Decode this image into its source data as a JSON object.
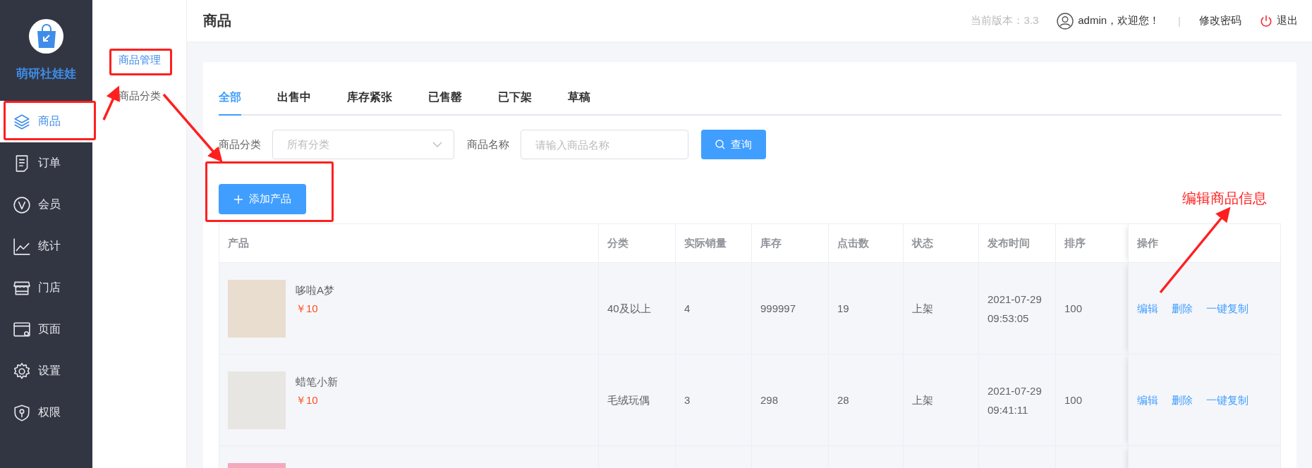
{
  "brand": {
    "name": "萌研社娃娃"
  },
  "nav": [
    {
      "label": "商品",
      "selected": true
    },
    {
      "label": "订单",
      "selected": false
    },
    {
      "label": "会员",
      "selected": false
    },
    {
      "label": "统计",
      "selected": false
    },
    {
      "label": "门店",
      "selected": false
    },
    {
      "label": "页面",
      "selected": false
    },
    {
      "label": "设置",
      "selected": false
    },
    {
      "label": "权限",
      "selected": false
    }
  ],
  "subnav": [
    {
      "label": "商品管理",
      "selected": true
    },
    {
      "label": "商品分类",
      "selected": false
    }
  ],
  "header": {
    "title": "商品",
    "version": "当前版本：3.3",
    "user": "admin，欢迎您！",
    "separator": "|",
    "change_password": "修改密码",
    "logout": "退出"
  },
  "tabs": [
    {
      "label": "全部",
      "selected": true
    },
    {
      "label": "出售中",
      "selected": false
    },
    {
      "label": "库存紧张",
      "selected": false
    },
    {
      "label": "已售罄",
      "selected": false
    },
    {
      "label": "已下架",
      "selected": false
    },
    {
      "label": "草稿",
      "selected": false
    }
  ],
  "filters": {
    "category_label": "商品分类",
    "category_placeholder": "所有分类",
    "name_label": "商品名称",
    "name_placeholder": "请输入商品名称",
    "search_button": "查询"
  },
  "add_button": "添加产品",
  "table": {
    "columns": [
      "产品",
      "分类",
      "实际销量",
      "库存",
      "点击数",
      "状态",
      "发布时间",
      "排序",
      "操作"
    ],
    "rows": [
      {
        "name": "哆啦A梦",
        "price": "￥10",
        "category": "40及以上",
        "sales": "4",
        "stock": "999997",
        "clicks": "19",
        "status": "上架",
        "published": "2021-07-29 09:53:05",
        "sort": "100",
        "actions": [
          "编辑",
          "删除",
          "一键复制"
        ]
      },
      {
        "name": "蜡笔小新",
        "price": "￥10",
        "category": "毛绒玩偶",
        "sales": "3",
        "stock": "298",
        "clicks": "28",
        "status": "上架",
        "published": "2021-07-29 09:41:11",
        "sort": "100",
        "actions": [
          "编辑",
          "删除",
          "一键复制"
        ]
      },
      {
        "partial": true
      }
    ]
  },
  "annotations": {
    "note": "编辑商品信息"
  }
}
